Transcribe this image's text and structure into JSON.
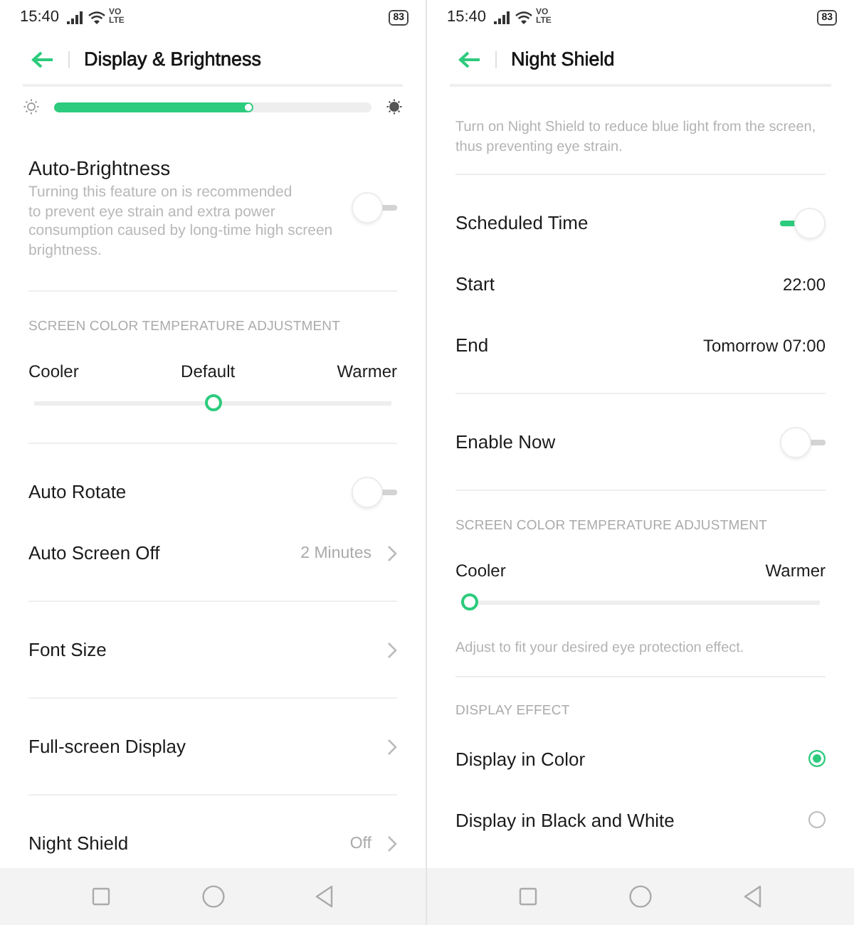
{
  "screens": [
    {
      "status_bar": {
        "time": "15:40",
        "network": [
          "VO",
          "LTE"
        ],
        "battery": "83"
      },
      "header": {
        "title": "Display & Brightness"
      },
      "groups": [
        {
          "items": [
            {
              "kind": "brightness",
              "level": 0.63
            },
            {
              "kind": "toggle",
              "label": "Auto-Brightness",
              "description": "Turning this feature on is recommended\nto prevent eye strain and extra power\nconsumption caused by long-time high screen\nbrightness.",
              "on": false
            }
          ]
        },
        {
          "items": [
            {
              "kind": "section",
              "label": "SCREEN COLOR TEMPERATURE ADJUSTMENT"
            },
            {
              "kind": "temperature",
              "labels": [
                "Cooler",
                "Default",
                "Warmer"
              ],
              "level": 0.5
            }
          ]
        },
        {
          "items": [
            {
              "kind": "toggle",
              "label": "Auto Rotate",
              "on": false
            },
            {
              "kind": "link",
              "label": "Auto Screen Off",
              "value": "2 Minutes"
            }
          ]
        },
        {
          "items": [
            {
              "kind": "link",
              "label": "Font Size"
            }
          ]
        },
        {
          "items": [
            {
              "kind": "link",
              "label": "Full-screen Display"
            }
          ]
        },
        {
          "items": [
            {
              "kind": "link",
              "label": "Night Shield",
              "value": "Off"
            }
          ]
        }
      ]
    },
    {
      "status_bar": {
        "time": "15:40",
        "network": [
          "VO",
          "LTE"
        ],
        "battery": "83"
      },
      "header": {
        "title": "Night Shield"
      },
      "groups": [
        {
          "items": [
            {
              "kind": "note",
              "text": "Turn on Night Shield to reduce blue light from the screen,\nthus preventing eye strain."
            }
          ]
        },
        {
          "items": [
            {
              "kind": "toggle",
              "label": "Scheduled Time",
              "on": true
            },
            {
              "kind": "value",
              "label": "Start",
              "value": "22:00"
            },
            {
              "kind": "value",
              "label": "End",
              "value": "Tomorrow 07:00"
            }
          ]
        },
        {
          "items": [
            {
              "kind": "toggle",
              "label": "Enable Now",
              "on": false
            }
          ]
        },
        {
          "items": [
            {
              "kind": "section",
              "label": "SCREEN COLOR TEMPERATURE ADJUSTMENT"
            },
            {
              "kind": "temperature",
              "labels": [
                "Cooler",
                "Warmer"
              ],
              "level": 0
            },
            {
              "kind": "note",
              "text": "Adjust to fit your desired eye protection effect."
            }
          ]
        },
        {
          "items": [
            {
              "kind": "section",
              "label": "DISPLAY EFFECT"
            },
            {
              "kind": "radio",
              "label": "Display in Color",
              "selected": true
            },
            {
              "kind": "radio",
              "label": "Display in Black and White",
              "selected": false
            }
          ]
        }
      ]
    }
  ]
}
